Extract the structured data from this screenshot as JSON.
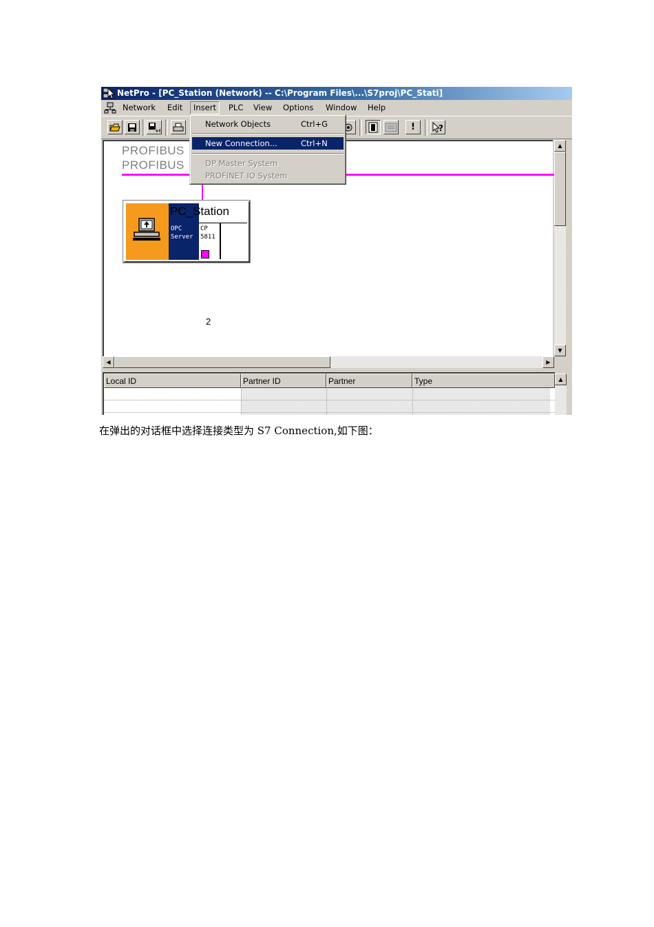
{
  "window": {
    "title": "NetPro - [PC_Station (Network) -- C:\\Program Files\\...\\S7proj\\PC_Stati]"
  },
  "menubar": {
    "items": [
      "Network",
      "Edit",
      "Insert",
      "PLC",
      "View",
      "Options",
      "Window",
      "Help"
    ],
    "open_menu": "Insert"
  },
  "insert_menu": {
    "items": [
      {
        "label": "Network Objects",
        "shortcut": "Ctrl+G",
        "state": "normal"
      },
      {
        "label": "New Connection...",
        "shortcut": "Ctrl+N",
        "state": "highlighted"
      },
      {
        "label": "DP Master System",
        "shortcut": "",
        "state": "disabled"
      },
      {
        "label": "PROFINET IO System",
        "shortcut": "",
        "state": "disabled"
      }
    ]
  },
  "toolbar": {
    "icons": [
      "open-icon",
      "save-icon",
      "save-compile-icon",
      "print-icon",
      "configure-icon",
      "catalog-icon",
      "overview-icon",
      "exclamation-icon",
      "help-pointer-icon"
    ],
    "exclamation_label": "!",
    "help_label": "?"
  },
  "network": {
    "subnet_labels": [
      "PROFIBUS",
      "PROFIBUS"
    ],
    "subnet_color": "#ff00ff",
    "station": {
      "name": "PC_Station",
      "opc_label": "OPC\nServer",
      "cp_label": "CP\n5811",
      "number": "2",
      "icon_color": "#f59a1c",
      "server_color": "#0a246a"
    }
  },
  "connection_table": {
    "columns": [
      "Local ID",
      "Partner ID",
      "Partner",
      "Type"
    ],
    "rows": []
  },
  "caption": "在弹出的对话框中选择连接类型为 S7 Connection,如下图："
}
